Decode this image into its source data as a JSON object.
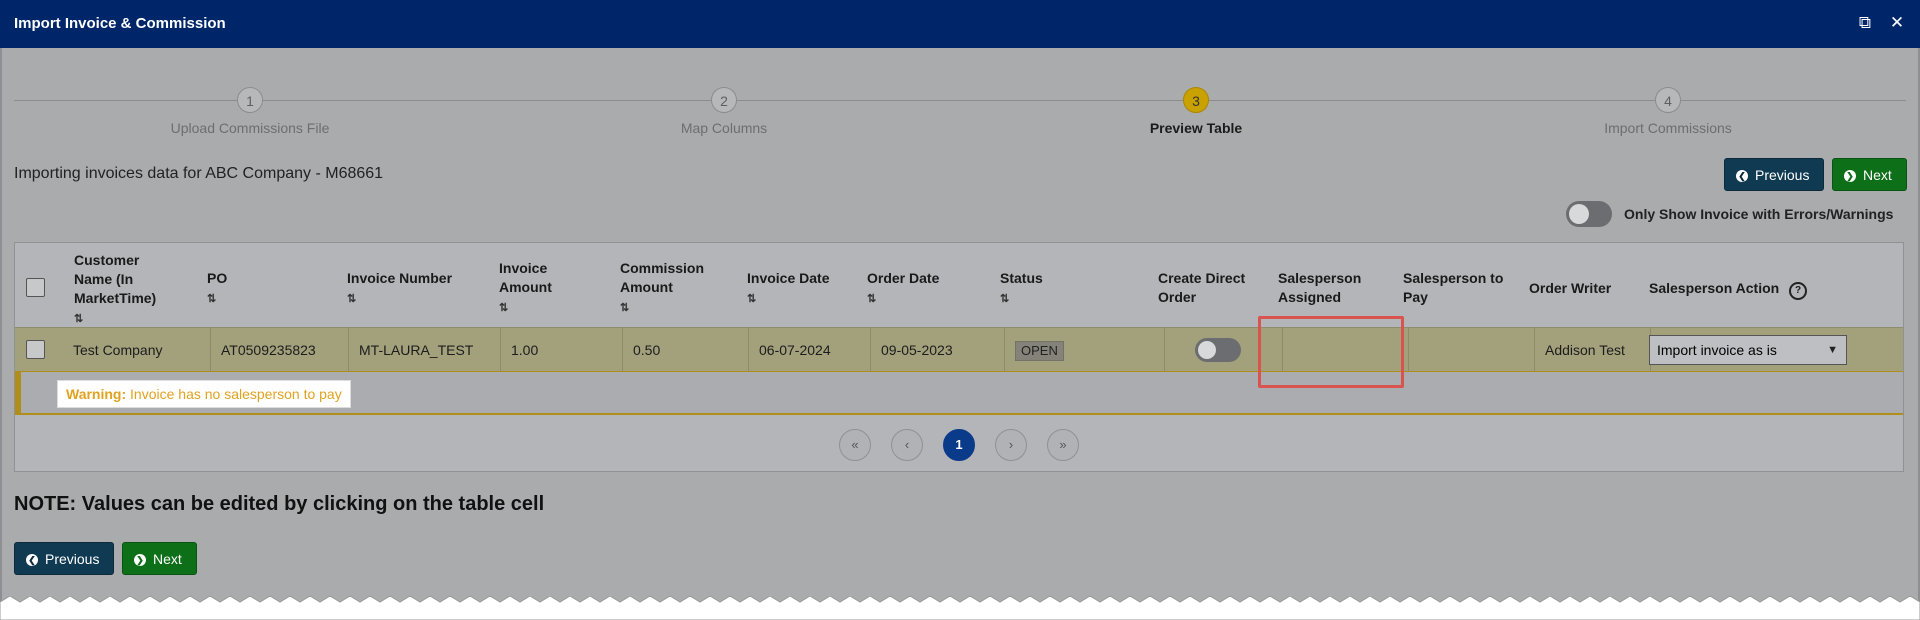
{
  "window": {
    "title": "Import Invoice & Commission"
  },
  "stepper": {
    "steps": [
      {
        "number": "1",
        "label": "Upload Commissions File"
      },
      {
        "number": "2",
        "label": "Map Columns"
      },
      {
        "number": "3",
        "label": "Preview Table"
      },
      {
        "number": "4",
        "label": "Import Commissions"
      }
    ],
    "active": 3
  },
  "heading": "Importing invoices data for ABC Company - M68661",
  "buttons": {
    "previous": "Previous",
    "next": "Next"
  },
  "filter_toggle": {
    "label": "Only Show Invoice with Errors/Warnings",
    "on": false
  },
  "table": {
    "headers": {
      "customer": "Customer Name (In MarketTime)",
      "po": "PO",
      "invoice_number": "Invoice Number",
      "invoice_amount": "Invoice Amount",
      "commission_amount": "Commission Amount",
      "invoice_date": "Invoice Date",
      "order_date": "Order Date",
      "status": "Status",
      "create_direct_order": "Create Direct Order",
      "salesperson_assigned": "Salesperson Assigned",
      "salesperson_to_pay": "Salesperson to Pay",
      "order_writer": "Order Writer",
      "salesperson_action": "Salesperson Action"
    },
    "sort_icon": "⇅",
    "row": {
      "customer": "Test Company",
      "po": "AT0509235823",
      "invoice_number": "MT-LAURA_TEST",
      "invoice_amount": "1.00",
      "commission_amount": "0.50",
      "invoice_date": "06-07-2024",
      "order_date": "09-05-2023",
      "status": "OPEN",
      "create_direct_order": false,
      "salesperson_assigned": "",
      "salesperson_to_pay": "",
      "order_writer": "Addison Test",
      "salesperson_action": "Import invoice as is"
    },
    "warning": {
      "label": "Warning:",
      "message": "Invoice has no salesperson to pay"
    }
  },
  "pagination": {
    "first": "«",
    "prev": "‹",
    "current": "1",
    "next": "›",
    "last": "»"
  },
  "note": "NOTE: Values can be edited by clicking on the table cell",
  "colors": {
    "titlebar": "#00266a",
    "next_button": "#0e6f19",
    "previous_button": "#0f3a52",
    "active_step": "#c9a100",
    "warning": "#e0a21f",
    "highlight": "#d9534f"
  }
}
